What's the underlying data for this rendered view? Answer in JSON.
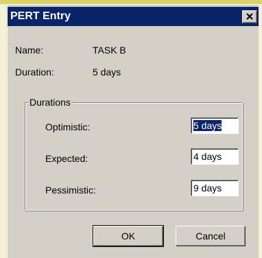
{
  "window": {
    "title": "PERT Entry",
    "close_glyph": "✕"
  },
  "info": {
    "name_label": "Name:",
    "name_value": "TASK B",
    "duration_label": "Duration:",
    "duration_value": "5 days"
  },
  "durations": {
    "group_label": "Durations",
    "optimistic_label": "Optimistic:",
    "optimistic_value": "5 days",
    "expected_label": "Expected:",
    "expected_value": "4 days",
    "pessimistic_label": "Pessimistic:",
    "pessimistic_value": "9 days"
  },
  "buttons": {
    "ok_label": "OK",
    "cancel_label": "Cancel"
  },
  "colors": {
    "titlebar": "#0a246a",
    "dialog_face": "#d4d0c8",
    "selection": "#0a246a"
  },
  "icons": {
    "close": "close-icon"
  }
}
